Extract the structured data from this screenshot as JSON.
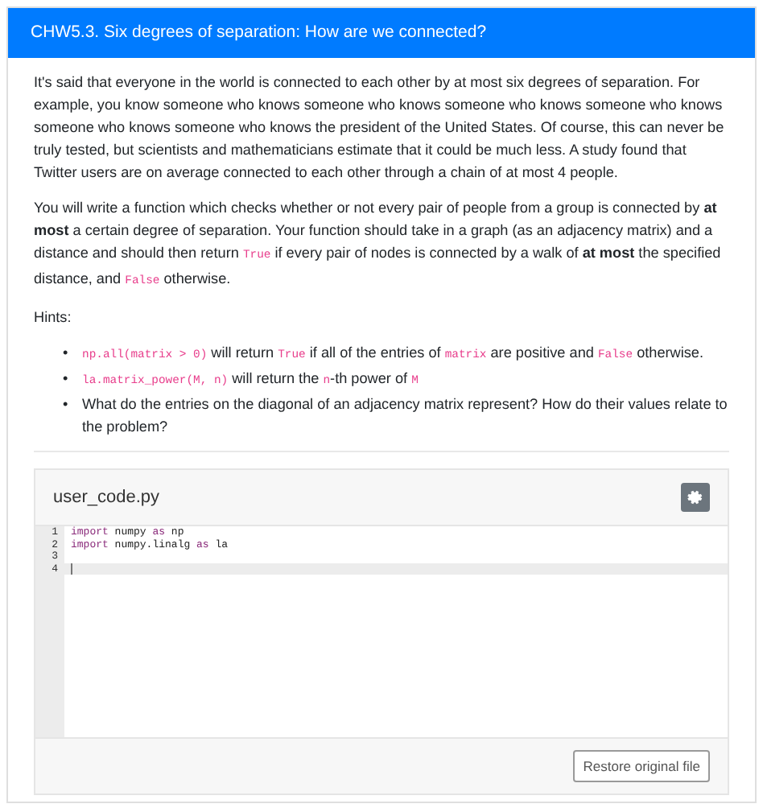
{
  "header": {
    "title": "CHW5.3. Six degrees of separation: How are we connected?"
  },
  "paragraphs": [
    [
      {
        "kind": "text",
        "text": "It's said that everyone in the world is connected to each other by at most six degrees of separation. For example, you know someone who knows someone who knows someone who knows someone who knows someone who knows someone who knows the president of the United States. Of course, this can never be truly tested, but scientists and mathematicians estimate that it could be much less. A study found that Twitter users are on average connected to each other through a chain of at most 4 people."
      }
    ],
    [
      {
        "kind": "text",
        "text": "You will write a function which checks whether or not every pair of people from a group is connected by "
      },
      {
        "kind": "bold",
        "text": "at most"
      },
      {
        "kind": "text",
        "text": " a certain degree of separation. Your function should take in a graph (as an adjacency matrix) and a distance and should then return "
      },
      {
        "kind": "code",
        "text": "True"
      },
      {
        "kind": "text",
        "text": " if every pair of nodes is connected by a walk of "
      },
      {
        "kind": "bold",
        "text": "at most"
      },
      {
        "kind": "text",
        "text": " the specified distance, and "
      },
      {
        "kind": "code",
        "text": "False"
      },
      {
        "kind": "text",
        "text": " otherwise."
      }
    ],
    [
      {
        "kind": "text",
        "text": "Hints:"
      }
    ]
  ],
  "hints": [
    [
      {
        "kind": "bullet",
        "text": "•"
      },
      {
        "kind": "code",
        "text": "np.all(matrix > 0)"
      },
      {
        "kind": "text",
        "text": " will return "
      },
      {
        "kind": "code",
        "text": "True"
      },
      {
        "kind": "text",
        "text": " if all of the entries of "
      },
      {
        "kind": "code",
        "text": "matrix"
      },
      {
        "kind": "text",
        "text": " are positive and "
      },
      {
        "kind": "code",
        "text": "False"
      },
      {
        "kind": "text",
        "text": " otherwise."
      }
    ],
    [
      {
        "kind": "bullet",
        "text": "•"
      },
      {
        "kind": "code",
        "text": "la.matrix_power(M, n)"
      },
      {
        "kind": "text",
        "text": " will return the "
      },
      {
        "kind": "code",
        "text": "n"
      },
      {
        "kind": "text",
        "text": "-th power of "
      },
      {
        "kind": "code",
        "text": "M"
      }
    ],
    [
      {
        "kind": "bullet",
        "text": "•"
      },
      {
        "kind": "text",
        "text": "What do the entries on the diagonal of an adjacency matrix represent? How do their values relate to the problem?"
      }
    ]
  ],
  "editor": {
    "filename": "user_code.py",
    "lines": [
      {
        "number": "1",
        "active": false,
        "tokens": [
          {
            "kind": "keyword",
            "text": "import"
          },
          {
            "kind": "plain",
            "text": " numpy "
          },
          {
            "kind": "keyword",
            "text": "as"
          },
          {
            "kind": "plain",
            "text": " np"
          }
        ]
      },
      {
        "number": "2",
        "active": false,
        "tokens": [
          {
            "kind": "keyword",
            "text": "import"
          },
          {
            "kind": "plain",
            "text": " numpy.linalg "
          },
          {
            "kind": "keyword",
            "text": "as"
          },
          {
            "kind": "plain",
            "text": " la"
          }
        ]
      },
      {
        "number": "3",
        "active": false
      },
      {
        "number": "4",
        "active": true
      }
    ],
    "restore_button": "Restore original file"
  }
}
